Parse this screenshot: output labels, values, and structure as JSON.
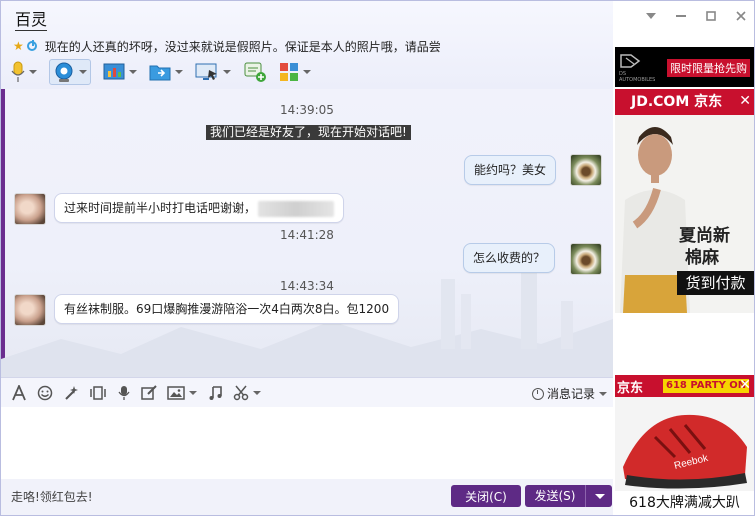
{
  "window": {
    "title": "百灵",
    "signature": "现在的人还真的坏呀，没过来就说是假照片。保证是本人的照片哦，请品尝"
  },
  "chat": {
    "system_message": "我们已经是好友了，现在开始对话吧!",
    "messages": [
      {
        "time": "14:39:05"
      },
      {
        "side": "right",
        "text": "能约吗？美女"
      },
      {
        "side": "left",
        "text": "过来时间提前半小时打电话吧谢谢，"
      },
      {
        "time": "14:41:28"
      },
      {
        "side": "right",
        "text": "怎么收费的？"
      },
      {
        "time": "14:43:34"
      },
      {
        "side": "left",
        "text": "有丝袜制服。69口爆胸推漫游陪浴一次4白两次8白。包1200"
      }
    ]
  },
  "input_toolbar": {
    "history_label": "消息记录"
  },
  "footer": {
    "notice": "走咯!领红包去!",
    "close_label": "关闭(C)",
    "send_label": "发送(S)"
  },
  "ads": {
    "ad1": {
      "logo_text": "DS AUTOMOBILES",
      "tag": "限时限量抢先购"
    },
    "ad2": {
      "header": "JD.COM 京东",
      "line1": "夏尚新",
      "line2": "棉麻",
      "footer": "货到付款"
    },
    "ad3": {
      "brand": "京东",
      "tag": "618 PARTY ON",
      "footer": "618大牌满减大趴",
      "shoe_brand": "Reebok"
    }
  }
}
